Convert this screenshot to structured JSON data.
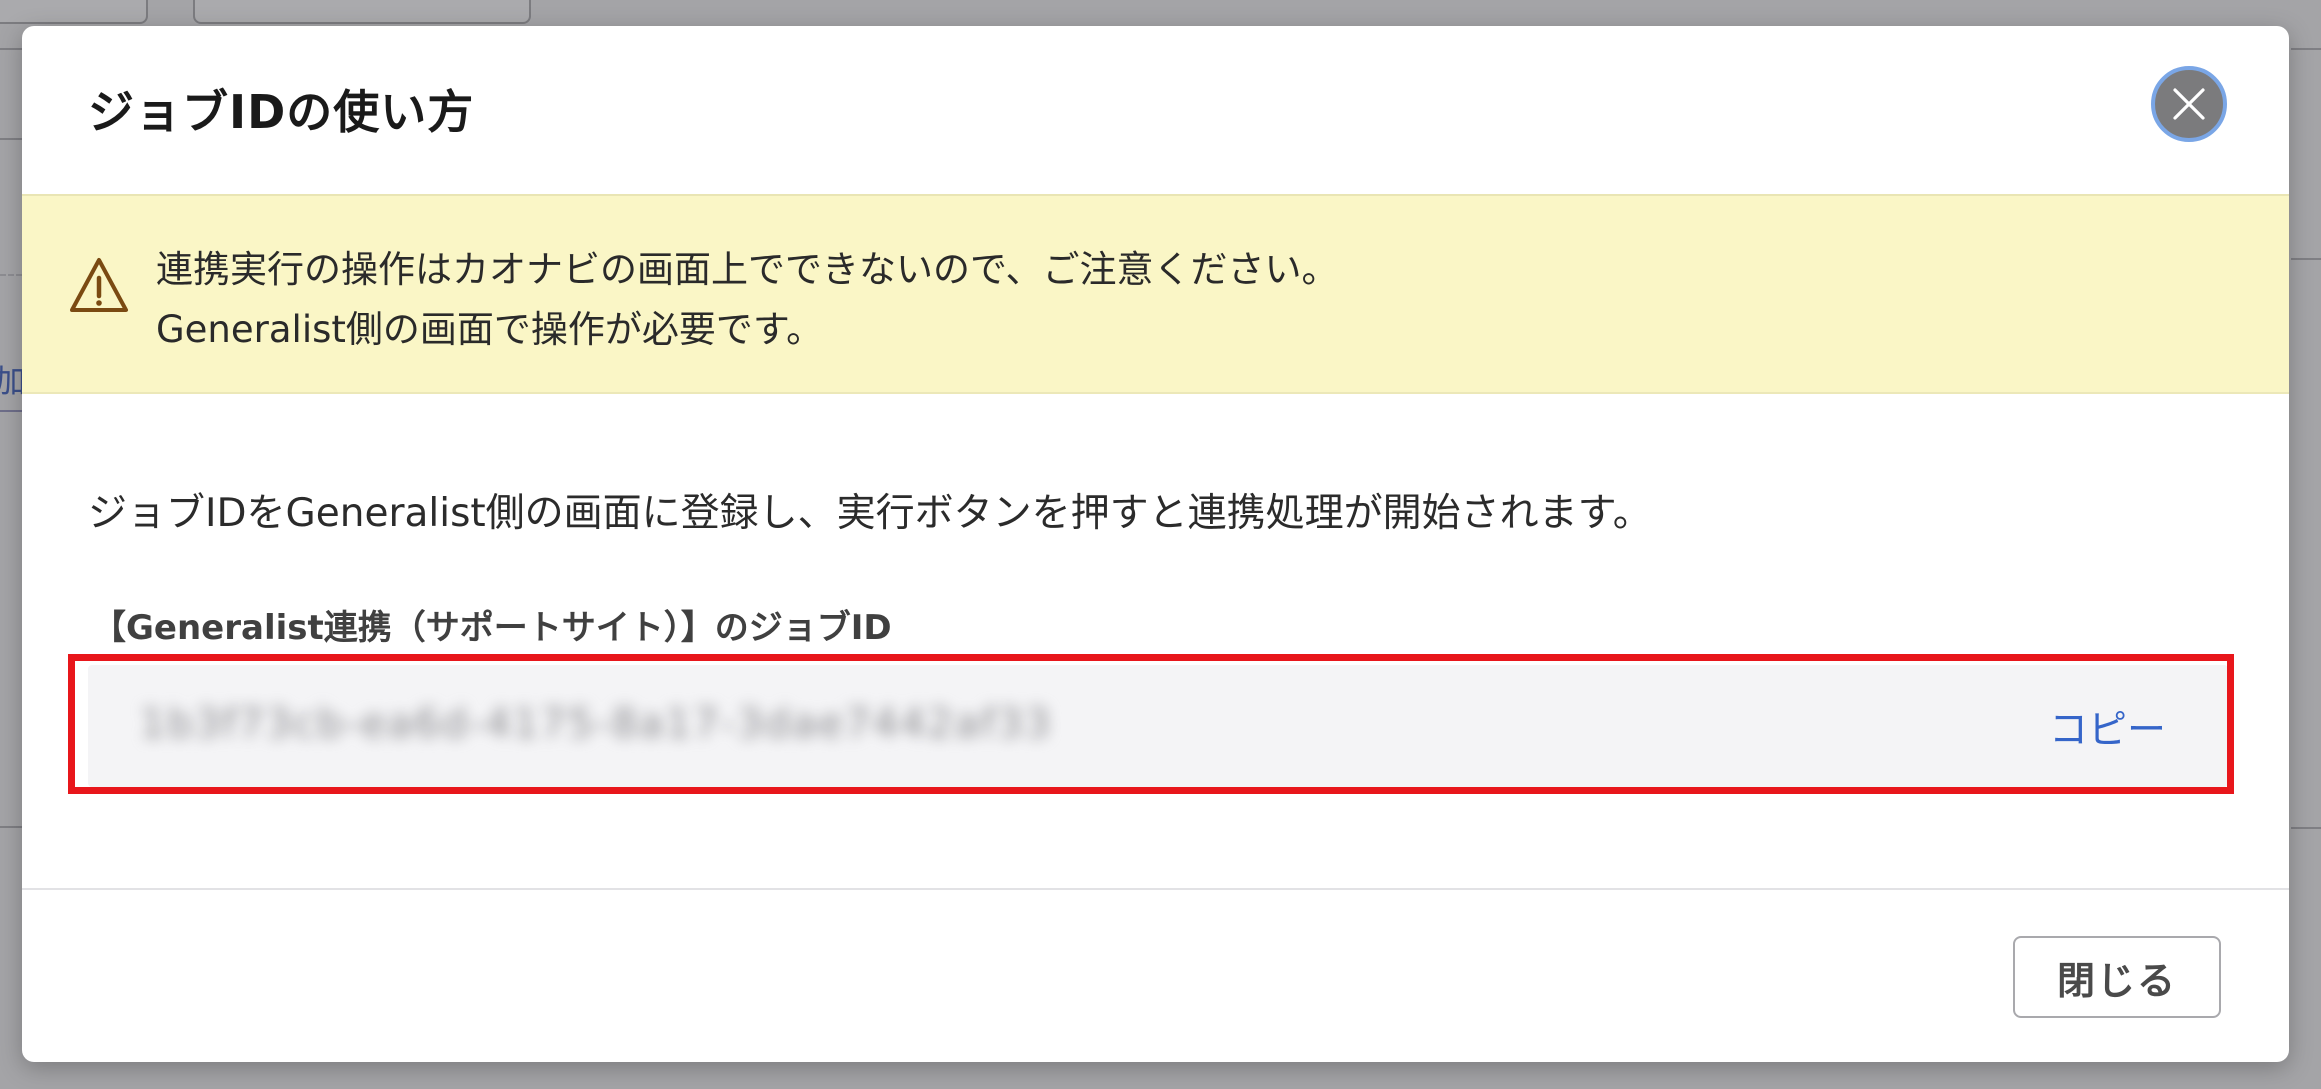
{
  "dialog": {
    "title": "ジョブIDの使い方",
    "close_icon": "close-icon"
  },
  "warning": {
    "icon": "warning-icon",
    "line1": "連携実行の操作はカオナビの画面上でできないので、ご注意ください。",
    "line2": "Generalist側の画面で操作が必要です。",
    "background": "#faf6c6"
  },
  "description": "ジョブIDをGeneralist側の画面に登録し、実行ボタンを押すと連携処理が開始されます。",
  "job_id_field": {
    "label": "【Generalist連携（サポートサイト）】のジョブID",
    "value": "1b3f73cb-ea6d-4175-8a17-3dae7442af33",
    "copy_label": "コピー",
    "highlight_color": "#e8161b"
  },
  "footer": {
    "close_label": "閉じる"
  },
  "background_page": {
    "partial_text": "加"
  },
  "colors": {
    "link": "#3565c9",
    "close_icon_bg": "#7b7b7d",
    "focus_ring": "#7aa6e6"
  }
}
